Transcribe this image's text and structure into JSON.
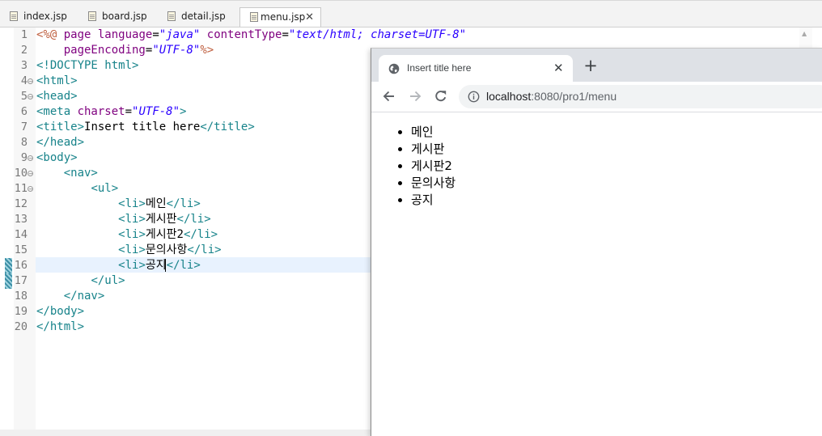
{
  "editor_tabs": [
    {
      "label": "index.jsp"
    },
    {
      "label": "board.jsp"
    },
    {
      "label": "detail.jsp"
    },
    {
      "label": "menu.jsp",
      "active": true,
      "close_icon": "close-icon"
    }
  ],
  "code": {
    "line_numbers": [
      "1",
      "2",
      "3",
      "4",
      "5",
      "6",
      "7",
      "8",
      "9",
      "10",
      "11",
      "12",
      "13",
      "14",
      "15",
      "16",
      "17",
      "18",
      "19",
      "20"
    ],
    "line1": {
      "open": "<%@",
      "p1": " page ",
      "a1": "language",
      "eq1": "=",
      "v1": "\"java\"",
      "sp": " ",
      "a2": "contentType",
      "eq2": "=",
      "v2": "\"text/html; charset=UTF-8\""
    },
    "line2": {
      "indent": "    ",
      "a1": "pageEncoding",
      "eq1": "=",
      "v1": "\"UTF-8\"",
      "close": "%>"
    },
    "line3": {
      "tag": "<!DOCTYPE html>"
    },
    "line4": {
      "tag": "<html>"
    },
    "line5": {
      "tag": "<head>"
    },
    "line6": {
      "t1": "<meta ",
      "a1": "charset",
      "eq1": "=",
      "v1": "\"UTF-8\"",
      "t2": ">"
    },
    "line7": {
      "t1": "<title>",
      "text": "Insert title here",
      "t2": "</title>"
    },
    "line8": {
      "tag": "</head>"
    },
    "line9": {
      "tag": "<body>"
    },
    "line10": {
      "indent": "    ",
      "tag": "<nav>"
    },
    "line11": {
      "indent": "        ",
      "tag": "<ul>"
    },
    "line12": {
      "indent": "            ",
      "t1": "<li>",
      "text": "메인",
      "t2": "</li>"
    },
    "line13": {
      "indent": "            ",
      "t1": "<li>",
      "text": "게시판",
      "t2": "</li>"
    },
    "line14": {
      "indent": "            ",
      "t1": "<li>",
      "text": "게시판2",
      "t2": "</li>"
    },
    "line15": {
      "indent": "            ",
      "t1": "<li>",
      "text": "문의사항",
      "t2": "</li>"
    },
    "line16": {
      "indent": "            ",
      "t1": "<li>",
      "text": "공지",
      "t2": "</li>"
    },
    "line17": {
      "indent": "        ",
      "tag": "</ul>"
    },
    "line18": {
      "indent": "    ",
      "tag": "</nav>"
    },
    "line19": {
      "tag": "</body>"
    },
    "line20": {
      "tag": "</html>"
    }
  },
  "browser": {
    "tab_title": "Insert title here",
    "tab_close": "✕",
    "new_tab": "+",
    "url_host": "localhost",
    "url_path": ":8080/pro1/menu",
    "list_items": [
      "메인",
      "게시판",
      "게시판2",
      "문의사항",
      "공지"
    ]
  },
  "icons": {
    "globe": "globe-icon",
    "back": "back-arrow-icon",
    "forward": "forward-arrow-icon",
    "reload": "reload-icon",
    "info": "info-icon",
    "file": "jsp-file-icon",
    "fold": "fold-collapse-icon"
  },
  "colors": {
    "tag": "#17838a",
    "attribute": "#7f007f",
    "value": "#2a00ff",
    "jsp_delimiter": "#bf5f3f",
    "current_line": "#e8f2fe",
    "browser_tabstrip": "#dee1e6"
  }
}
